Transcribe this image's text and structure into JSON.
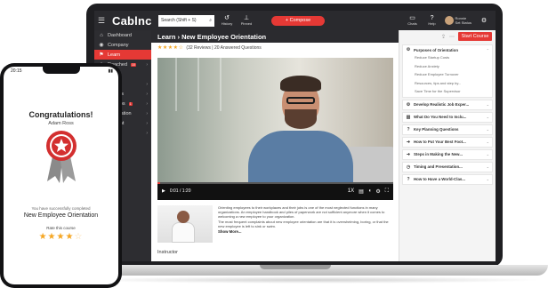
{
  "app": {
    "brand": "Cablnc",
    "search_label": "Search (Shift + S)",
    "history_label": "History",
    "pinned_label": "Pinned",
    "compose_label": "+ Compose",
    "chats_label": "Chats",
    "help_label": "Help",
    "user_name": "Ronnie",
    "user_status": "Set Status"
  },
  "sidebar": {
    "items": [
      {
        "label": "Dashboard",
        "icon": "home-icon",
        "active": false,
        "chevron": false
      },
      {
        "label": "Company",
        "icon": "company-icon",
        "active": false,
        "chevron": false
      },
      {
        "label": "Learn",
        "icon": "learn-icon",
        "active": true,
        "chevron": false
      },
      {
        "label": "Reached",
        "icon": "reached-icon",
        "active": false,
        "chevron": true,
        "badge": "10"
      },
      {
        "label": "ile",
        "icon": "file-icon",
        "active": false,
        "chevron": false
      },
      {
        "label": "",
        "icon": "blank-icon",
        "active": false,
        "chevron": true
      },
      {
        "label": "uments",
        "icon": "document-icon",
        "active": false,
        "chevron": true
      },
      {
        "label": "te Maps",
        "icon": "map-icon",
        "active": false,
        "chevron": true,
        "badge": "1"
      },
      {
        "label": "munication",
        "icon": "chat-icon",
        "active": false,
        "chevron": true
      },
      {
        "label": "gement",
        "icon": "gear-icon",
        "active": false,
        "chevron": true
      },
      {
        "label": "ctivity",
        "icon": "activity-icon",
        "active": false,
        "chevron": true
      },
      {
        "label": "",
        "icon": "blank-icon",
        "active": false,
        "chevron": false
      },
      {
        "label": "tions",
        "icon": "options-icon",
        "active": false,
        "chevron": false
      }
    ]
  },
  "main": {
    "title": "Learn › New Employee Orientation",
    "stars_display": "★★★★☆",
    "rating_value": 4,
    "rating_text": "(32 Reviews | 20 Answered Questions",
    "video": {
      "time": "0:01 / 1:20",
      "speed": "1X",
      "progress": 0.01
    },
    "description": [
      "Orienting employees to their workplaces and their jobs is one of the most neglected functions in many organizations. An employee handbook and piles of paperwork are not sufficient anymore when it comes to welcoming a new employee to your organization.",
      "The most frequent complaints about new employee orientation are that it is overwhelming, boring, or that the new employee is left to sink or swim."
    ],
    "show_more": "Show More...",
    "instructor_label": "Instructor"
  },
  "right_panel": {
    "start_label": "Start Course",
    "modules": [
      {
        "title": "Purposes of Orientation",
        "icon": "gear-icon",
        "open": true,
        "subitems": [
          "Reduce Startup Costs",
          "Reduce Anxiety",
          "Reduce Employee Turnover",
          "Resources, tips and step by...",
          "Save Time for the Supervisor"
        ]
      },
      {
        "title": "Develop Realistic Job Exper...",
        "icon": "gear-icon",
        "open": false
      },
      {
        "title": "What Do You Need to Inclu...",
        "icon": "book-icon",
        "open": false
      },
      {
        "title": "Key Planning Questions",
        "icon": "question-icon",
        "open": false
      },
      {
        "title": "How to Put Your Best Foot...",
        "icon": "arrow-icon",
        "open": false
      },
      {
        "title": "Steps in Making the New...",
        "icon": "arrow-icon",
        "open": false
      },
      {
        "title": "Timing and Presentation...",
        "icon": "clock-icon",
        "open": false
      },
      {
        "title": "How to Have a World-Clas...",
        "icon": "question-icon",
        "open": false
      }
    ]
  },
  "phone": {
    "time": "20:15",
    "congrats": "Congratulations!",
    "name": "Adam Ross",
    "completed_text": "You have successfully completed",
    "course": "New Employee Orientation",
    "rate_label": "Rate this course",
    "rating_value": 4,
    "rating_max": 5
  },
  "colors": {
    "accent": "#e53935",
    "dark": "#2a2a2e",
    "star": "#f5a623"
  }
}
